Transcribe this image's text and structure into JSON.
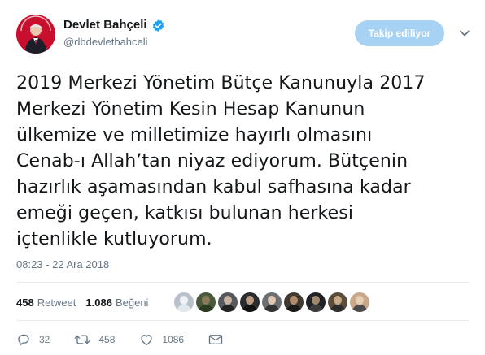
{
  "user": {
    "display_name": "Devlet Bahçeli",
    "handle": "@dbdevletbahceli",
    "verified": true,
    "follow_button_label": "Takip ediliyor"
  },
  "tweet": {
    "text": "2019 Merkezi Yönetim Bütçe Kanunuyla 2017\nMerkezi Yönetim Kesin Hesap Kanunun\nülkemize ve milletimize hayırlı olmasını\nCenab-ı Allah’tan niyaz ediyorum. Bütçenin\nhazırlık aşamasından kabul safhasına kadar\nemeği geçen, katkısı bulunan herkesi\niçtenlikle kutluyorum.",
    "timestamp": "08:23 - 22 Ara 2018"
  },
  "stats": {
    "retweet_count": "458",
    "retweet_label": "Retweet",
    "like_count": "1.086",
    "like_label": "Beğeni",
    "liker_avatars": [
      "avatar-1",
      "avatar-2",
      "avatar-3",
      "avatar-4",
      "avatar-5",
      "avatar-6",
      "avatar-7",
      "avatar-8",
      "avatar-9"
    ]
  },
  "actions": {
    "reply_count": "32",
    "retweet_count": "458",
    "like_count": "1086"
  },
  "icons": {
    "verified": "verified-badge-icon",
    "caret": "chevron-down-icon",
    "reply": "reply-icon",
    "retweet": "retweet-icon",
    "like": "heart-icon",
    "message": "envelope-icon"
  },
  "colors": {
    "accent": "#1da1f2",
    "follow_button_bg": "#a8d2f3",
    "secondary_text": "#657786"
  }
}
